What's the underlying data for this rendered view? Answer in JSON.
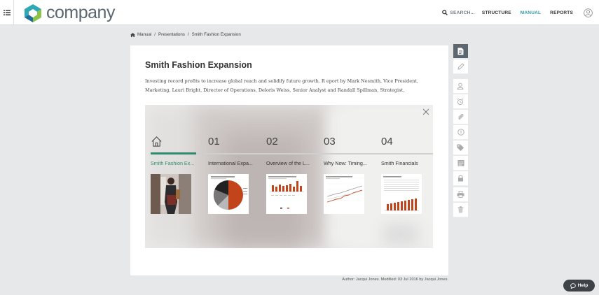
{
  "app": {
    "logo_text": "company"
  },
  "nav": {
    "search_label": "SEARCH...",
    "items": [
      {
        "label": "STRUCTURE",
        "active": false
      },
      {
        "label": "MANUAL",
        "active": true
      },
      {
        "label": "REPORTS",
        "active": false
      }
    ]
  },
  "breadcrumb": {
    "items": [
      "Manual",
      "Presentations",
      "Smith Fashion Expansion"
    ],
    "separator": "/"
  },
  "document": {
    "title": "Smith Fashion Expansion",
    "description": "Investing record profits to increase global reach and solidify future growth. R eport by Mark Nesmith, Vice President, Marketing, Lauri Bright, Director of Operations, Deloris Weiss, Senior Analyst and Randall Spillman, Strategist."
  },
  "viewer": {
    "tabs": [
      {
        "number": "",
        "icon": "home-icon",
        "label": "Smith Fashion Ex...",
        "active": true
      },
      {
        "number": "01",
        "label": "International Expa...",
        "active": false
      },
      {
        "number": "02",
        "label": "Overview of the L...",
        "active": false
      },
      {
        "number": "03",
        "label": "Why Now: Timing...",
        "active": false
      },
      {
        "number": "04",
        "label": "Smith Financials",
        "active": false
      }
    ]
  },
  "footer": {
    "text": "Author: Jacqui Jones. Modified: 03 Jul 2016 by Jacqui Jones."
  },
  "help": {
    "label": "Help"
  },
  "colors": {
    "accent": "#2e9aa0",
    "active_tab": "#2e8b70",
    "chart_orange": "#c1441a",
    "toolbar_dark": "#5c6770"
  }
}
